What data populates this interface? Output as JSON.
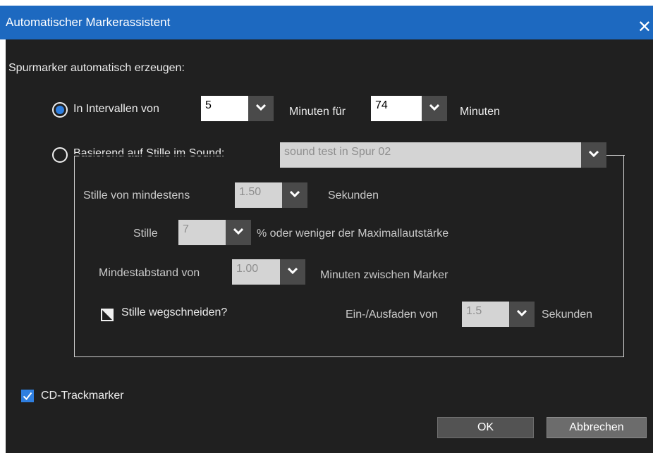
{
  "window": {
    "title": "Automatischer Markerassistent",
    "close_glyph": "✕"
  },
  "section_label": "Spurmarker automatisch erzeugen:",
  "interval": {
    "radio_label": "In Intervallen von",
    "every_value": "5",
    "minutes_for_label": "Minuten für",
    "total_value": "74",
    "minutes_label": "Minuten"
  },
  "silence": {
    "radio_label": "Basierend auf Stille im Sound:",
    "track_value": "sound test in Spur 02",
    "min_silence_label": "Stille von mindestens",
    "min_silence_value": "1.50",
    "seconds_label": "Sekunden",
    "stille_label": "Stille",
    "threshold_value": "7",
    "threshold_suffix": "% oder weniger der Maximallautstärke",
    "min_distance_label": "Mindestabstand von",
    "min_distance_value": "1.00",
    "min_distance_suffix": "Minuten zwischen Marker",
    "cut_label": "Stille wegschneiden?",
    "fade_label": "Ein-/Ausfaden von",
    "fade_value": "1.5",
    "fade_suffix": "Sekunden"
  },
  "cd_trackmarker_label": "CD-Trackmarker",
  "buttons": {
    "ok": "OK",
    "cancel": "Abbrechen"
  },
  "colors": {
    "titlebar": "#1d69c0",
    "background": "#202020",
    "accent": "#2f7fe0"
  },
  "icons": [
    "close-icon",
    "chevron-down-icon",
    "radio-selected-icon",
    "radio-empty-icon",
    "checkbox-checked-icon",
    "checkbox-indeterminate-icon"
  ]
}
